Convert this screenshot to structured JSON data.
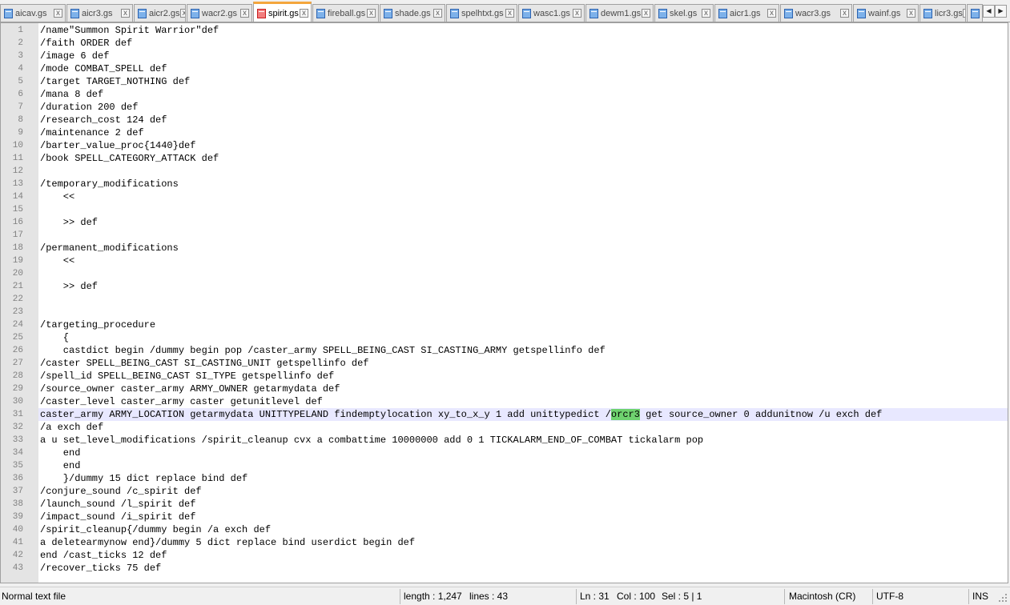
{
  "tabs": [
    {
      "label": "aicav.gs",
      "active": false
    },
    {
      "label": "aicr3.gs",
      "active": false
    },
    {
      "label": "aicr2.gs",
      "active": false
    },
    {
      "label": "wacr2.gs",
      "active": false
    },
    {
      "label": "spirit.gs",
      "active": true
    },
    {
      "label": "fireball.gs",
      "active": false
    },
    {
      "label": "shade.gs",
      "active": false
    },
    {
      "label": "spelhtxt.gs",
      "active": false
    },
    {
      "label": "wasc1.gs",
      "active": false
    },
    {
      "label": "dewm1.gs",
      "active": false
    },
    {
      "label": "skel.gs",
      "active": false
    },
    {
      "label": "aicr1.gs",
      "active": false
    },
    {
      "label": "wacr3.gs",
      "active": false
    },
    {
      "label": "wainf.gs",
      "active": false
    },
    {
      "label": "licr3.gs",
      "active": false
    },
    {
      "label": "",
      "active": false
    }
  ],
  "tab_close_glyph": "x",
  "tab_scroll": {
    "left": "◀",
    "right": "▶"
  },
  "editor": {
    "current_line": 31,
    "highlight": {
      "line": 31,
      "before": "caster_army ARMY_LOCATION getarmydata UNITTYPELAND findemptylocation xy_to_x_y 1 add unittypedict /",
      "match": "orcr3",
      "after": " get source_owner 0 addunitnow /u exch def"
    },
    "lines": [
      {
        "n": "1",
        "text": "/name\"Summon Spirit Warrior\"def"
      },
      {
        "n": "2",
        "text": "/faith ORDER def"
      },
      {
        "n": "3",
        "text": "/image 6 def"
      },
      {
        "n": "4",
        "text": "/mode COMBAT_SPELL def"
      },
      {
        "n": "5",
        "text": "/target TARGET_NOTHING def"
      },
      {
        "n": "6",
        "text": "/mana 8 def"
      },
      {
        "n": "7",
        "text": "/duration 200 def"
      },
      {
        "n": "8",
        "text": "/research_cost 124 def"
      },
      {
        "n": "9",
        "text": "/maintenance 2 def"
      },
      {
        "n": "10",
        "text": "/barter_value_proc{1440}def"
      },
      {
        "n": "11",
        "text": "/book SPELL_CATEGORY_ATTACK def"
      },
      {
        "n": "12",
        "text": ""
      },
      {
        "n": "13",
        "text": "/temporary_modifications"
      },
      {
        "n": "14",
        "text": "    <<"
      },
      {
        "n": "15",
        "text": ""
      },
      {
        "n": "16",
        "text": "    >> def"
      },
      {
        "n": "17",
        "text": ""
      },
      {
        "n": "18",
        "text": "/permanent_modifications"
      },
      {
        "n": "19",
        "text": "    <<"
      },
      {
        "n": "20",
        "text": ""
      },
      {
        "n": "21",
        "text": "    >> def"
      },
      {
        "n": "22",
        "text": ""
      },
      {
        "n": "23",
        "text": ""
      },
      {
        "n": "24",
        "text": "/targeting_procedure"
      },
      {
        "n": "25",
        "text": "    {"
      },
      {
        "n": "26",
        "text": "    castdict begin /dummy begin pop /caster_army SPELL_BEING_CAST SI_CASTING_ARMY getspellinfo def"
      },
      {
        "n": "27",
        "text": "/caster SPELL_BEING_CAST SI_CASTING_UNIT getspellinfo def"
      },
      {
        "n": "28",
        "text": "/spell_id SPELL_BEING_CAST SI_TYPE getspellinfo def"
      },
      {
        "n": "29",
        "text": "/source_owner caster_army ARMY_OWNER getarmydata def"
      },
      {
        "n": "30",
        "text": "/caster_level caster_army caster getunitlevel def"
      },
      {
        "n": "31",
        "text": "caster_army ARMY_LOCATION getarmydata UNITTYPELAND findemptylocation xy_to_x_y 1 add unittypedict /orcr3 get source_owner 0 addunitnow /u exch def"
      },
      {
        "n": "32",
        "text": "/a exch def"
      },
      {
        "n": "33",
        "text": "a u set_level_modifications /spirit_cleanup cvx a combattime 10000000 add 0 1 TICKALARM_END_OF_COMBAT tickalarm pop"
      },
      {
        "n": "34",
        "text": "    end"
      },
      {
        "n": "35",
        "text": "    end"
      },
      {
        "n": "36",
        "text": "    }/dummy 15 dict replace bind def"
      },
      {
        "n": "37",
        "text": "/conjure_sound /c_spirit def"
      },
      {
        "n": "38",
        "text": "/launch_sound /l_spirit def"
      },
      {
        "n": "39",
        "text": "/impact_sound /i_spirit def"
      },
      {
        "n": "40",
        "text": "/spirit_cleanup{/dummy begin /a exch def"
      },
      {
        "n": "41",
        "text": "a deletearmynow end}/dummy 5 dict replace bind userdict begin def"
      },
      {
        "n": "42",
        "text": "end /cast_ticks 12 def"
      },
      {
        "n": "43",
        "text": "/recover_ticks 75 def"
      }
    ]
  },
  "status": {
    "file_type": "Normal text file",
    "length": "length : 1,247",
    "lines": "lines : 43",
    "ln": "Ln : 31",
    "col": "Col : 100",
    "sel": "Sel : 5 | 1",
    "eol": "Macintosh (CR)",
    "encoding": "UTF-8",
    "mode": "INS"
  },
  "colors": {
    "active_tab_accent": "#f4a63c",
    "match_highlight": "#6fd26f",
    "current_line": "#e8e8ff"
  }
}
